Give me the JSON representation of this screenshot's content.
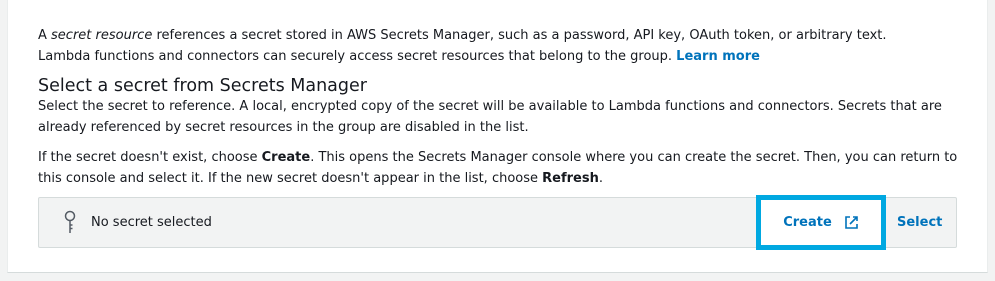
{
  "intro": {
    "prefix": "A ",
    "term": "secret resource",
    "suffix": " references a secret stored in AWS Secrets Manager, such as a password, API key, OAuth token, or arbitrary text. Lambda functions and connectors can securely access secret resources that belong to the group. ",
    "learn_more": "Learn more"
  },
  "section": {
    "title": "Select a secret from Secrets Manager",
    "description": "Select the secret to reference. A local, encrypted copy of the secret will be available to Lambda functions and connectors. Secrets that are already referenced by secret resources in the group are disabled in the list."
  },
  "help": {
    "p1": "If the secret doesn't exist, choose ",
    "create_word": "Create",
    "p2": ". This opens the Secrets Manager console where you can create the secret. Then, you can return to this console and select it. If the new secret doesn't appear in the list, choose ",
    "refresh_word": "Refresh",
    "p3": "."
  },
  "selector": {
    "status": "No secret selected",
    "icon": "key-icon",
    "create_label": "Create",
    "create_icon": "external-link-icon",
    "select_label": "Select"
  },
  "colors": {
    "link": "#0073bb",
    "highlight_border": "#00a8e1",
    "selector_bg": "#f2f3f3"
  }
}
